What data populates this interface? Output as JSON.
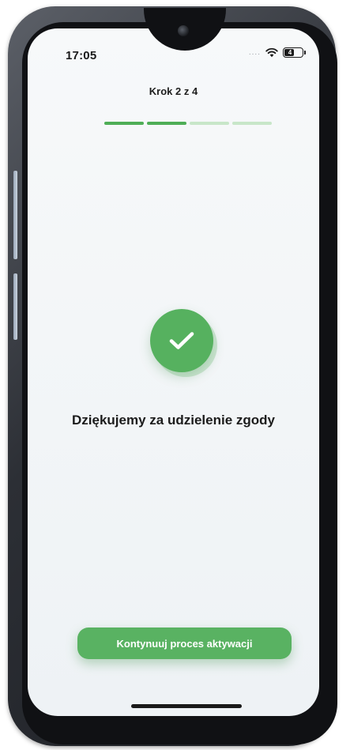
{
  "status_bar": {
    "time": "17:05",
    "signal": "....",
    "battery_level": "4",
    "wifi_icon": "wifi-icon",
    "battery_icon": "battery-icon"
  },
  "header": {
    "step_label": "Krok 2 z 4",
    "progress": {
      "current_step": 2,
      "total_steps": 4
    }
  },
  "main": {
    "success_icon": "checkmark-icon",
    "message": "Dziękujemy za udzielenie zgody"
  },
  "footer": {
    "continue_label": "Kontynuuj proces aktywacji"
  },
  "colors": {
    "accent": "#56b15f",
    "progress_done": "#4fae57",
    "progress_pending": "#c8e6c9",
    "background": "#f4f7f8"
  }
}
